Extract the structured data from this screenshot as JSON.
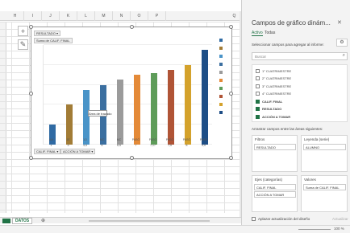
{
  "columns": [
    "H",
    "I",
    "J",
    "K",
    "L",
    "M",
    "N",
    "O",
    "P",
    "Q"
  ],
  "pivot": {
    "report_filter_btn": "RESULTADO",
    "value_btn": "Suma de CALIF. FINAL",
    "row_btns": [
      "CALIF. FINAL",
      "ACCIÓN A TOMAR"
    ],
    "tooltip": "Área de trazado"
  },
  "chart_data": {
    "type": "bar",
    "categories": [
      "AM",
      "1E",
      "1O",
      "MC",
      "MC",
      "PASÓ",
      "PASÓ",
      "PASÓ",
      "PASÓ",
      "PASÓ"
    ],
    "values": [
      2,
      4,
      5.5,
      6,
      6.5,
      7,
      7.17,
      7.5,
      8,
      9.5
    ],
    "value_labels": [
      "1",
      "3",
      "4,5",
      "6",
      "6,5",
      "7",
      "7,17",
      "7,5",
      "8",
      "9,5"
    ],
    "colors": [
      "#2f6aa3",
      "#a27c36",
      "#4a94c8",
      "#3b6fa0",
      "#9b9b9b",
      "#e48a38",
      "#5e9c59",
      "#b05436",
      "#d4a22c",
      "#1e4e86"
    ],
    "ylim": [
      0,
      10
    ]
  },
  "sheet_tab": "DATOS",
  "panel": {
    "title": "Campos de gráfico dinám...",
    "tabs": [
      "Activo",
      "Todas"
    ],
    "prompt": "Seleccionar campos para agregar al informe:",
    "search_placeholder": "Buscar",
    "fields": [
      {
        "label": "1° CUATRIMESTRE",
        "checked": false
      },
      {
        "label": "2° CUATRIMESTRE",
        "checked": false
      },
      {
        "label": "3° CUATRIMESTRE",
        "checked": false
      },
      {
        "label": "4° CUATRIMESTRE",
        "checked": false
      },
      {
        "label": "CALIF. FINAL",
        "checked": true
      },
      {
        "label": "RESULTADO",
        "checked": true
      },
      {
        "label": "ACCIÓN A TOMAR",
        "checked": true
      }
    ],
    "drag_hint": "Arrastrar campos entre las áreas siguientes:",
    "filters_label": "Filtros",
    "filters_value": "RESULTADO",
    "legend_label": "Leyenda (serie)",
    "legend_value": "ALUMNO",
    "axis_label": "Ejes (categorías)",
    "axis_values": [
      "CALIF. FINAL",
      "ACCIÓN A TOMAR"
    ],
    "values_label": "Valores",
    "values_value": "Suma de CALIF. FINAL",
    "defer_label": "Aplazar actualización del diseño",
    "update_label": "Actualizar"
  },
  "zoom": "100 %"
}
